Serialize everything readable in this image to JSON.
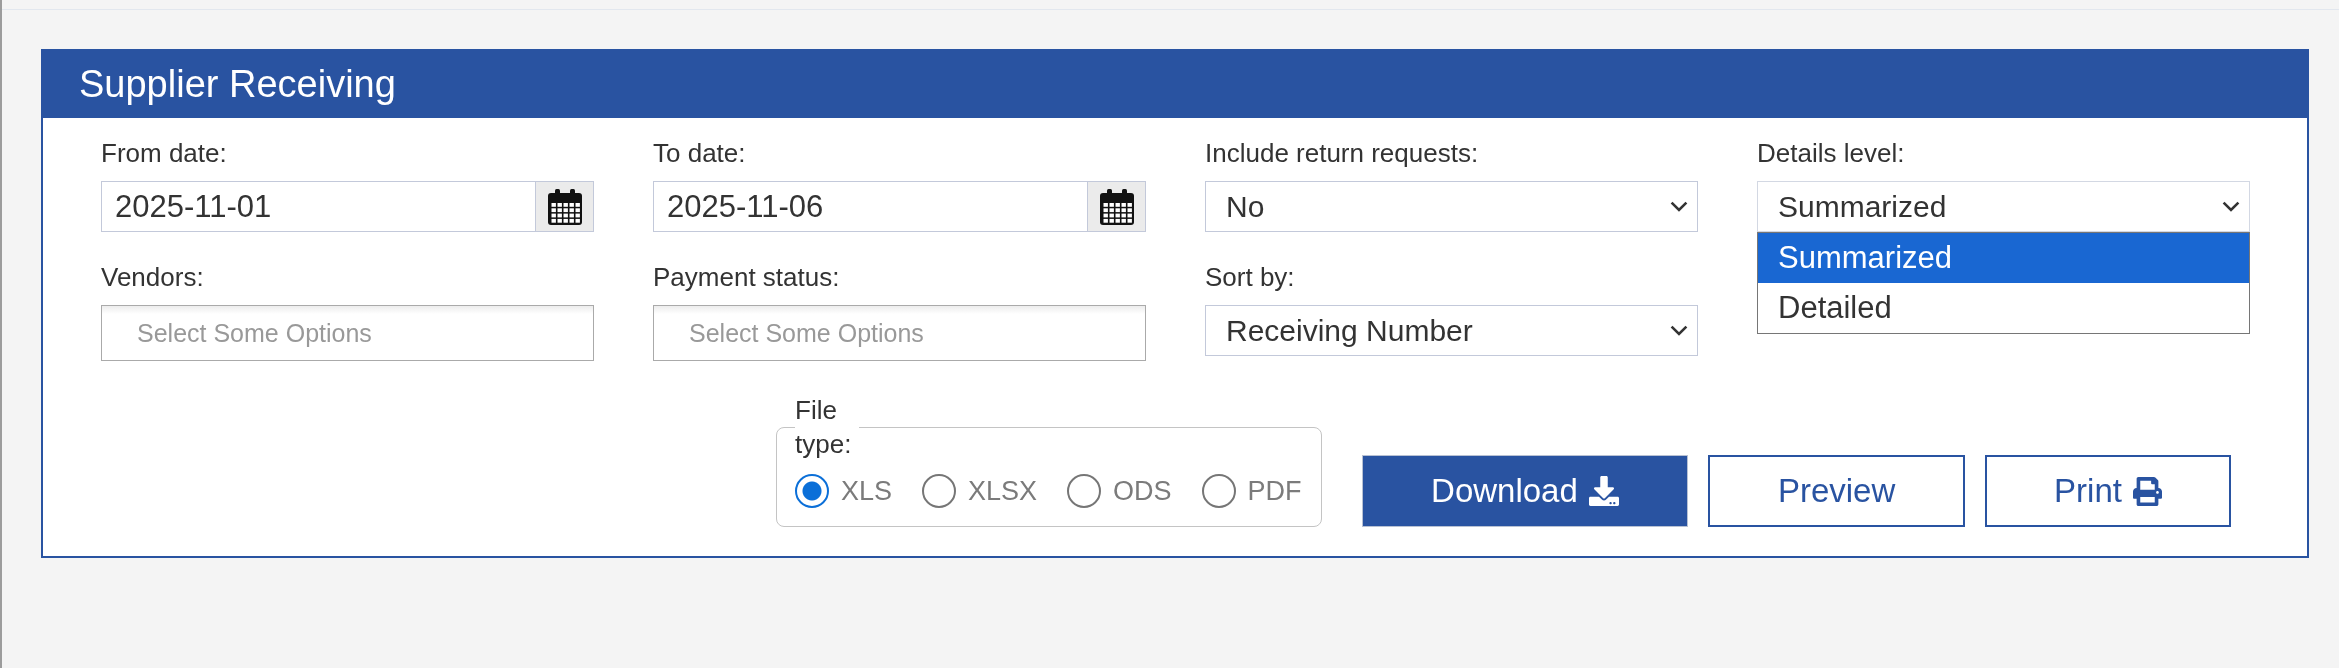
{
  "panel": {
    "title": "Supplier Receiving"
  },
  "fields": [
    {
      "kind": "date",
      "label": "From date:",
      "value": "2025-11-01"
    },
    {
      "kind": "date",
      "label": "To date:",
      "value": "2025-11-06"
    },
    {
      "kind": "select",
      "label": "Include return requests:",
      "value": "No",
      "expanded": false
    },
    {
      "kind": "select",
      "label": "Details level:",
      "value": "Summarized",
      "expanded": true,
      "options": [
        {
          "label": "Summarized",
          "selected": true
        },
        {
          "label": "Detailed",
          "selected": false
        }
      ]
    },
    {
      "kind": "multiselect",
      "label": "Vendors:",
      "placeholder": "Select Some Options"
    },
    {
      "kind": "multiselect",
      "label": "Payment status:",
      "placeholder": "Select Some Options"
    },
    {
      "kind": "select",
      "label": "Sort by:",
      "value": "Receiving Number",
      "expanded": false
    }
  ],
  "file_type": {
    "legend": "File type:",
    "options": [
      {
        "label": "XLS",
        "selected": true
      },
      {
        "label": "XLSX",
        "selected": false
      },
      {
        "label": "ODS",
        "selected": false
      },
      {
        "label": "PDF",
        "selected": false
      }
    ]
  },
  "buttons": [
    {
      "kind": "primary",
      "label": "Download"
    },
    {
      "kind": "outline",
      "label": "Preview"
    },
    {
      "kind": "outline",
      "label": "Print"
    }
  ]
}
